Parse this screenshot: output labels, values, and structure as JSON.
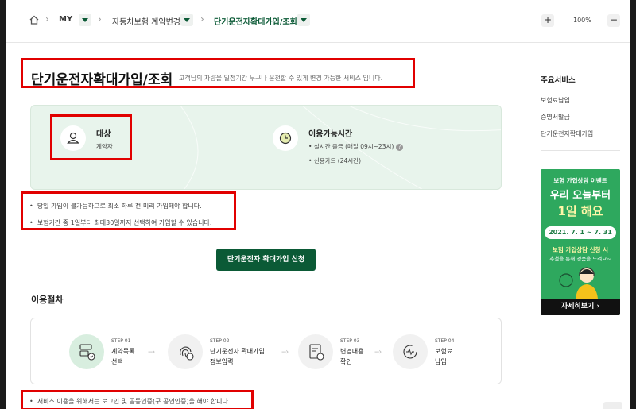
{
  "breadcrumb": {
    "items": [
      "MY",
      "자동차보험 계약변경",
      "단기운전자확대가입/조회"
    ],
    "zoom": "100%",
    "zoom_in": "+",
    "zoom_out": "−"
  },
  "page": {
    "title": "단기운전자확대가입/조회",
    "description": "고객님의 차량을 일정기간 누구나 운전할 수 있게 변경 가능한 서비스 입니다."
  },
  "info": {
    "target_label": "대상",
    "target_value": "계약자",
    "hours_label": "이용가능시간",
    "hours_items": [
      "실시간 출금 (매일 09시~23시)",
      "신용카드 (24시간)"
    ],
    "help": "?"
  },
  "notes": [
    "당일 가입이 불가능하므로 최소 하루 전 미리 가입해야 합니다.",
    "보험기간 중 1일부터 최대30일까지 선택하여 가입할 수 있습니다."
  ],
  "apply_button": "단기운전자 확대가입 신청",
  "procedure": {
    "title": "이용절차",
    "steps": [
      {
        "num": "STEP 01",
        "line1": "계약목록",
        "line2": "선택"
      },
      {
        "num": "STEP 02",
        "line1": "단기운전자 확대가입",
        "line2": "정보입력"
      },
      {
        "num": "STEP 03",
        "line1": "변경내용",
        "line2": "확인"
      },
      {
        "num": "STEP 04",
        "line1": "보험료",
        "line2": "납입"
      }
    ]
  },
  "bottom_note": "서비스 이용을 위해서는 로그인 및 공동인증(구 공인인증)을 해야 합니다.",
  "sidebar": {
    "title": "주요서비스",
    "items": [
      "보험료납입",
      "증명서발급",
      "단기운전자확대가입"
    ]
  },
  "banner": {
    "line1": "보험 가입상담 이벤트",
    "line2": "우리 오늘부터",
    "line3": "1일 해요",
    "date": "2021. 7. 1 ~ 7. 31",
    "line4": "보험 가입상담 신청 시",
    "line5": "추첨을 통해 경품을 드려요~",
    "more": "자세히보기 ›"
  },
  "colors": {
    "brand_green": "#0b5a36",
    "card_bg": "#e8f4ec",
    "highlight_red": "#e10000",
    "banner_green": "#2ea85e"
  }
}
